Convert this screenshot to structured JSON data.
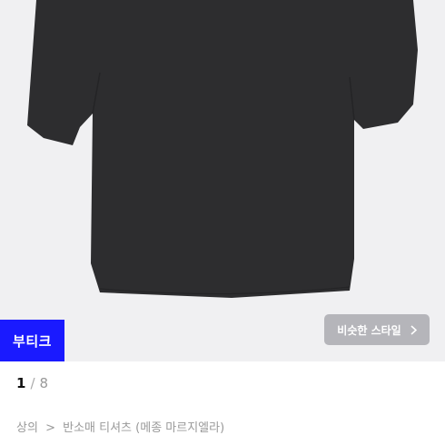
{
  "product": {
    "badge_label": "부티크",
    "similar_style_label": "비슷한 스타일",
    "similar_style_icon": "chevron-right-icon",
    "image_bg_color": "#f0f0f2",
    "shirt_color": "#2d2d2f"
  },
  "pager": {
    "current": "1",
    "separator": "/",
    "total": "8"
  },
  "breadcrumb": {
    "level1": "상의",
    "separator": ">",
    "level2": "반소매 티셔츠",
    "brand": "(메종 마르지엘라)"
  }
}
